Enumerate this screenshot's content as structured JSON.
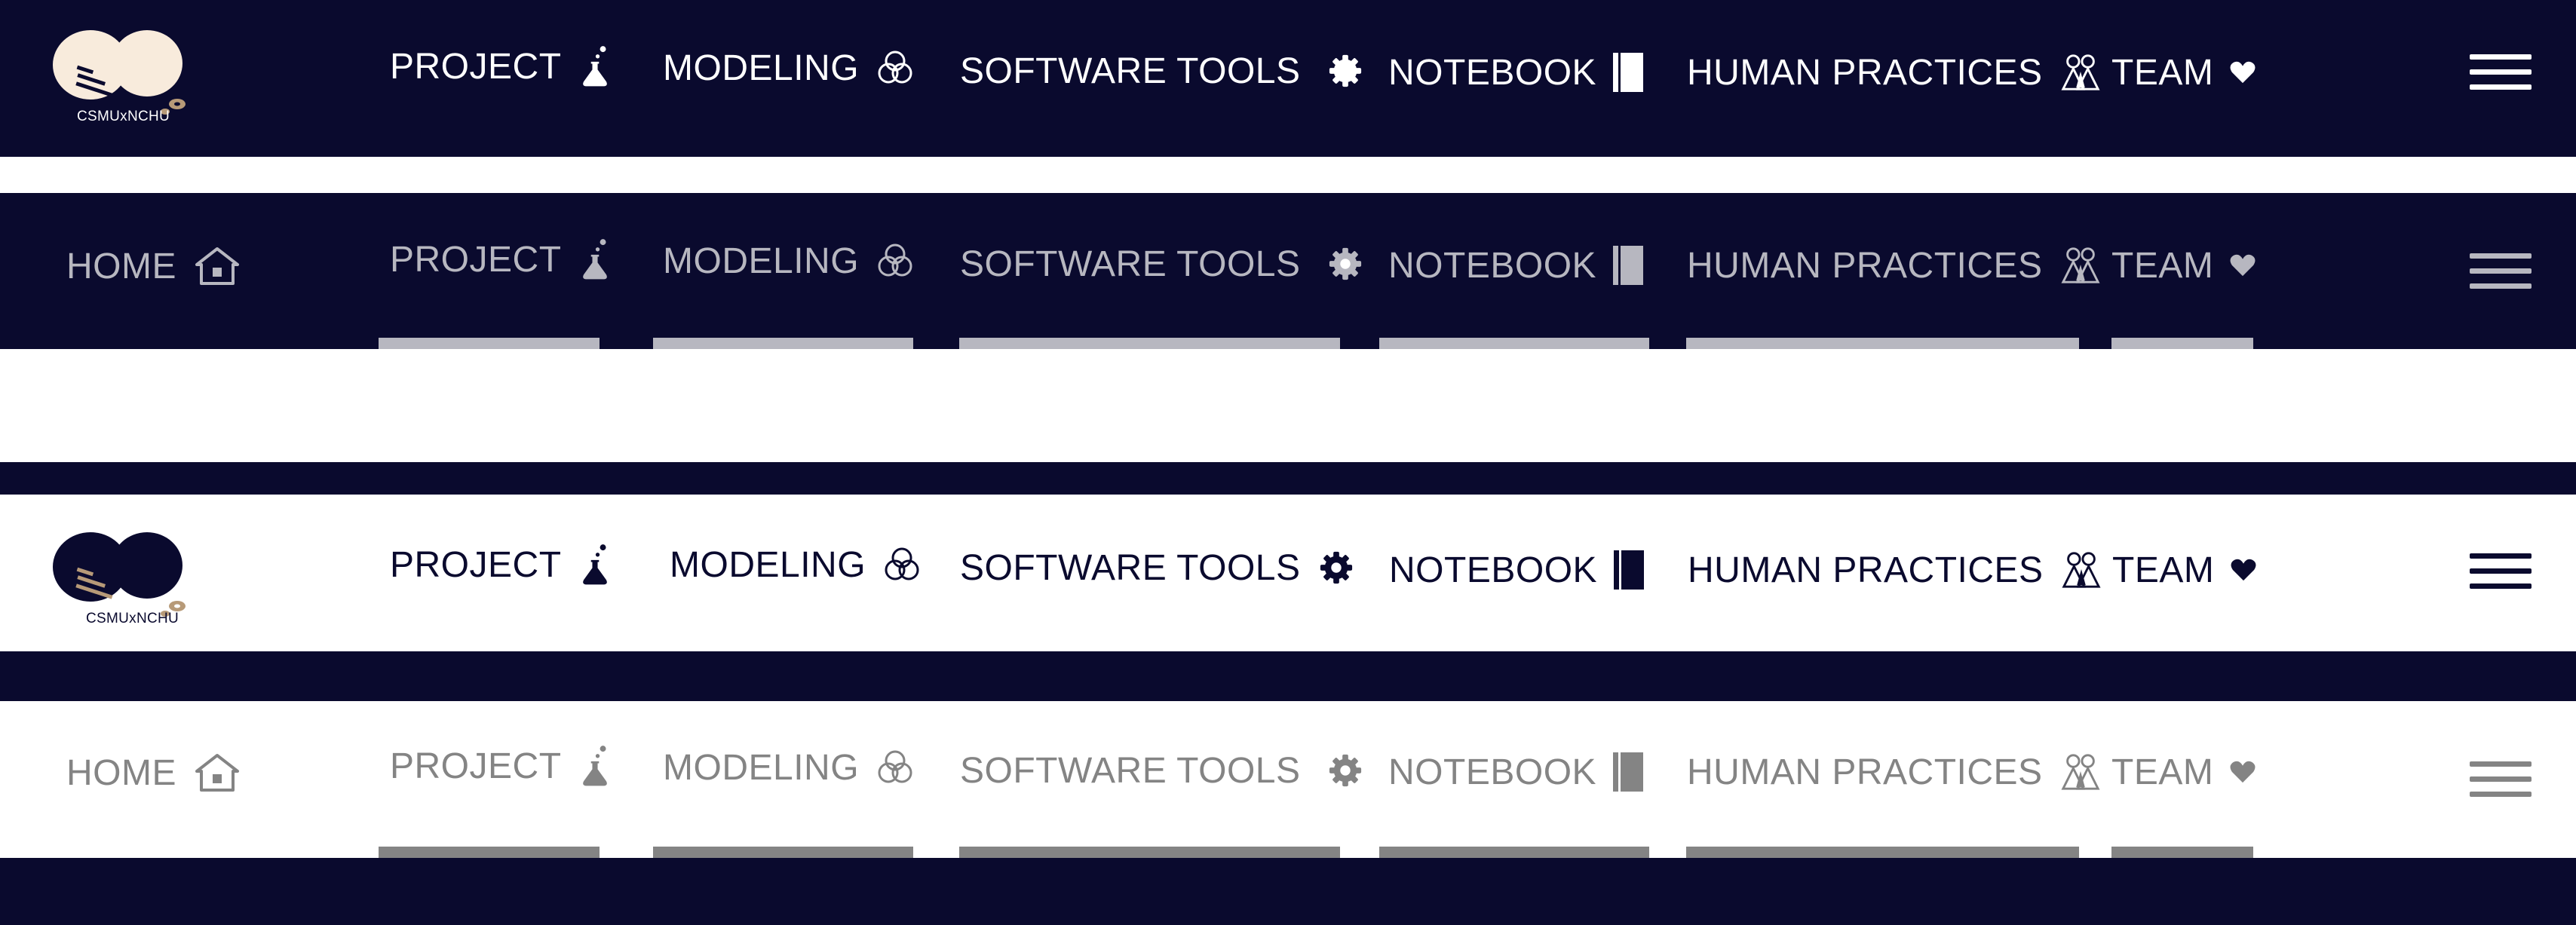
{
  "logo": {
    "text": "CSMUxNCHU"
  },
  "nav": {
    "home": "HOME",
    "project": "PROJECT",
    "modeling": "MODELING",
    "software_tools": "SOFTWARE TOOLS",
    "notebook": "NOTEBOOK",
    "human_practices": "HUMAN PRACTICES",
    "team": "TEAM"
  },
  "icons": {
    "home": "house-icon",
    "project": "flask-icon",
    "modeling": "three-circles-icon",
    "software_tools": "gear-icon",
    "notebook": "notebook-icon",
    "human_practices": "people-icon",
    "team": "heart-icon",
    "menu": "hamburger-menu-icon"
  },
  "colors": {
    "navy": "#0a0a2e",
    "white": "#ffffff",
    "light_gray": "#b7b7c0",
    "dark_gray": "#848484",
    "logo_cream": "#f8ebdc",
    "logo_tan": "#b79a78"
  }
}
